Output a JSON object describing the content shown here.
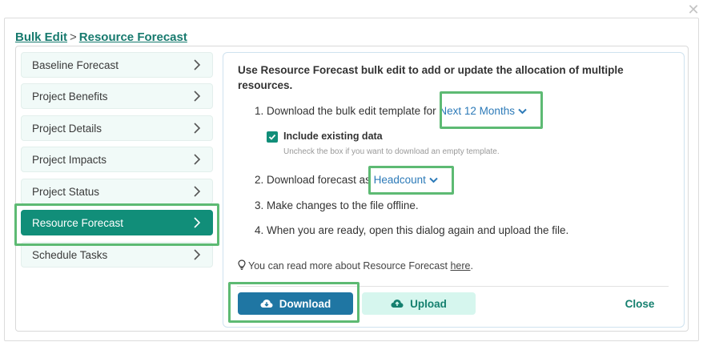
{
  "breadcrumb": {
    "root": "Bulk Edit",
    "separator": ">",
    "current": "Resource Forecast"
  },
  "sidebar": {
    "items": [
      {
        "label": "Baseline Forecast"
      },
      {
        "label": "Project Benefits"
      },
      {
        "label": "Project Details"
      },
      {
        "label": "Project Impacts"
      },
      {
        "label": "Project Status"
      },
      {
        "label": "Resource Forecast"
      },
      {
        "label": "Schedule Tasks"
      }
    ],
    "active_index": 5
  },
  "content": {
    "intro": "Use Resource Forecast bulk edit to add or update the allocation of multiple resources.",
    "step1_prefix": "1. Download the bulk edit template for",
    "step1_period": "Next 12 Months",
    "include_label": "Include existing data",
    "include_checked": true,
    "include_hint": "Uncheck the box if you want to download an empty template.",
    "step2_prefix": "2. Download forecast as",
    "step2_unit": "Headcount",
    "step3": "3. Make changes to the file offline.",
    "step4": "4. When you are ready, open this dialog again and upload the file.",
    "info_text": "You can read more about Resource Forecast",
    "info_link": "here",
    "info_suffix": "."
  },
  "buttons": {
    "download": "Download",
    "upload": "Upload",
    "close": "Close"
  },
  "icons": {
    "dialog_close": "close-icon",
    "sidebar_chevron": "chevron-right-icon",
    "dropdown": "chevron-down-icon",
    "checkbox": "check-icon",
    "info": "lightbulb-icon",
    "download": "cloud-download-icon",
    "upload": "cloud-upload-icon"
  },
  "colors": {
    "accent": "#118e79",
    "link": "#2c7ab8",
    "primary_button": "#1f76a3",
    "highlight": "#5dba73"
  }
}
